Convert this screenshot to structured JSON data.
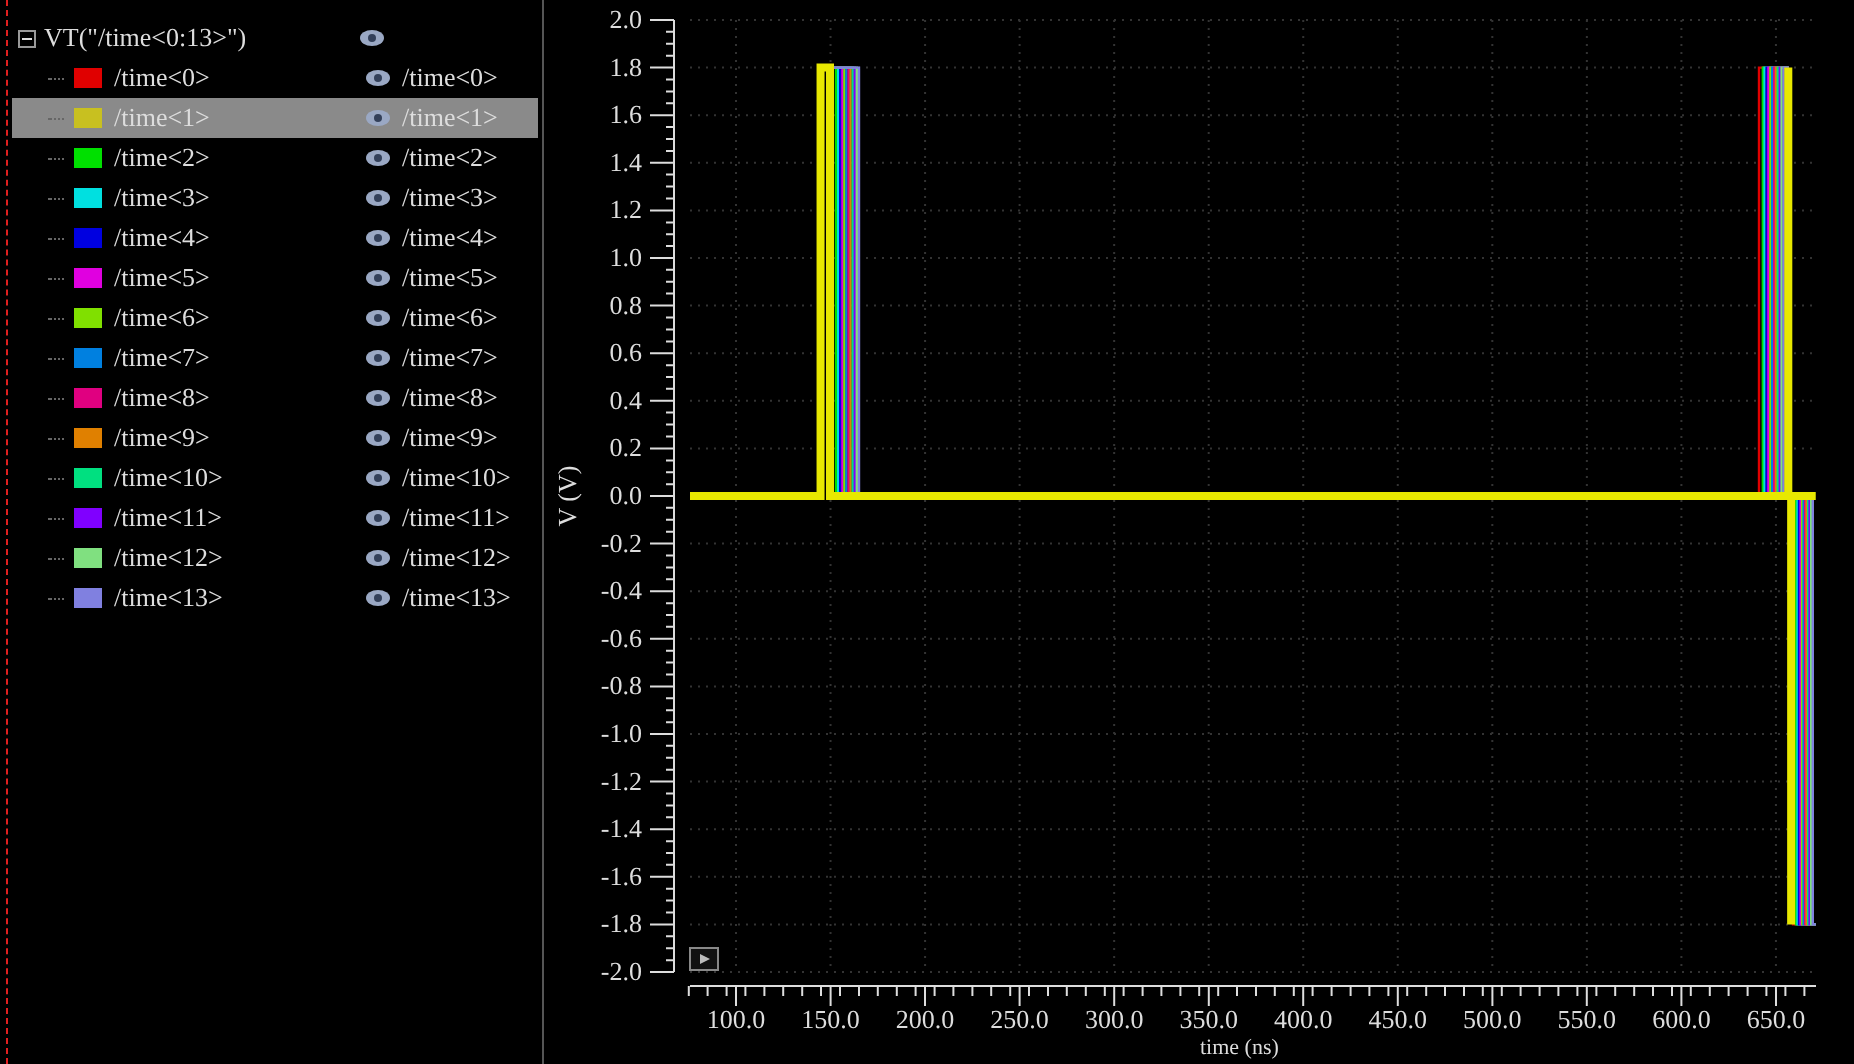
{
  "tree": {
    "label": "VT(\"/time<0:13>\")",
    "expanded": true,
    "children": [
      {
        "label": "/time<0>",
        "trace": "/time<0>",
        "color": "#e00000",
        "selected": false
      },
      {
        "label": "/time<1>",
        "trace": "/time<1>",
        "color": "#c8c020",
        "selected": true
      },
      {
        "label": "/time<2>",
        "trace": "/time<2>",
        "color": "#00e000",
        "selected": false
      },
      {
        "label": "/time<3>",
        "trace": "/time<3>",
        "color": "#00e0e0",
        "selected": false
      },
      {
        "label": "/time<4>",
        "trace": "/time<4>",
        "color": "#0000e0",
        "selected": false
      },
      {
        "label": "/time<5>",
        "trace": "/time<5>",
        "color": "#e000e0",
        "selected": false
      },
      {
        "label": "/time<6>",
        "trace": "/time<6>",
        "color": "#80e000",
        "selected": false
      },
      {
        "label": "/time<7>",
        "trace": "/time<7>",
        "color": "#0080e0",
        "selected": false
      },
      {
        "label": "/time<8>",
        "trace": "/time<8>",
        "color": "#e00080",
        "selected": false
      },
      {
        "label": "/time<9>",
        "trace": "/time<9>",
        "color": "#e08000",
        "selected": false
      },
      {
        "label": "/time<10>",
        "trace": "/time<10>",
        "color": "#00e080",
        "selected": false
      },
      {
        "label": "/time<11>",
        "trace": "/time<11>",
        "color": "#8000ff",
        "selected": false
      },
      {
        "label": "/time<12>",
        "trace": "/time<12>",
        "color": "#80e080",
        "selected": false
      },
      {
        "label": "/time<13>",
        "trace": "/time<13>",
        "color": "#8080e0",
        "selected": false
      }
    ]
  },
  "plot": {
    "ylabel": "V (V)",
    "xlabel": "time (ns)",
    "yticks": [
      "2.0",
      "1.8",
      "1.6",
      "1.4",
      "1.2",
      "1.0",
      "0.8",
      "0.6",
      "0.4",
      "0.2",
      "0.0",
      "-0.2",
      "-0.4",
      "-0.6",
      "-0.8",
      "-1.0",
      "-1.2",
      "-1.4",
      "-1.6",
      "-1.8",
      "-2.0"
    ],
    "xticks": [
      "100.0",
      "150.0",
      "200.0",
      "250.0",
      "300.0",
      "350.0",
      "400.0",
      "450.0",
      "500.0",
      "550.0",
      "600.0",
      "650.0"
    ]
  }
}
